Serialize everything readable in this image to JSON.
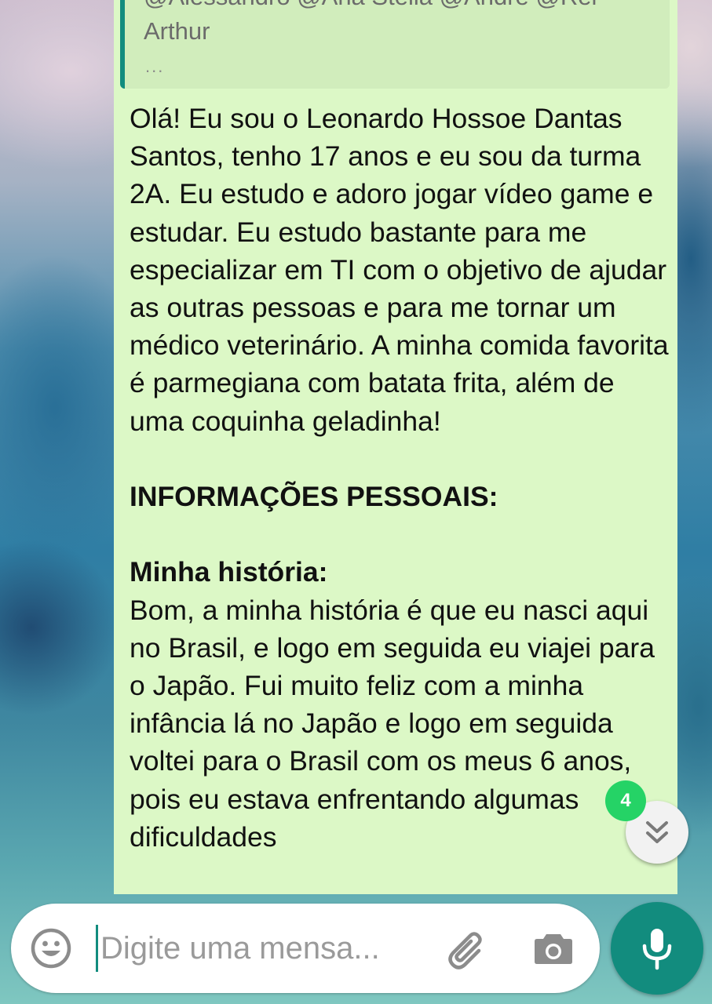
{
  "message": {
    "quoted": {
      "line1": "@Alessandro @Ana Stella @André @Rei",
      "line2": "Arthur",
      "more": "..."
    },
    "paragraphs": [
      {
        "text": "Olá! Eu sou o Leonardo Hossoe Dantas Santos, tenho 17 anos e eu sou da turma 2A. Eu estudo e adoro jogar vídeo game e estudar. Eu estudo bastante para me especializar em TI com o objetivo de ajudar as outras pessoas e para me tornar um médico veterinário. A minha comida favorita é parmegiana com batata frita, além de uma coquinha geladinha!"
      },
      {
        "text": "INFORMAÇÕES PESSOAIS:"
      },
      {
        "text": "Minha história:"
      },
      {
        "text": "Bom, a minha história é que eu nasci aqui no Brasil, e logo em seguida eu viajei para o Japão. Fui muito feliz com a minha infância lá no Japão e logo em seguida voltei para o Brasil com os meus 6 anos, pois eu estava enfrentando algumas dificuldades"
      }
    ]
  },
  "scroll_button": {
    "unread_count": "4"
  },
  "input": {
    "placeholder": "Digite uma mensa..."
  },
  "icons": {
    "emoji": "emoji-icon",
    "attach": "paperclip-icon",
    "camera": "camera-icon",
    "mic": "microphone-icon",
    "scroll": "double-chevron-down-icon"
  },
  "colors": {
    "bubble": "#dcf8c6",
    "quote_bar": "#128c7e",
    "mic_button": "#128c7e",
    "badge": "#25d366"
  }
}
